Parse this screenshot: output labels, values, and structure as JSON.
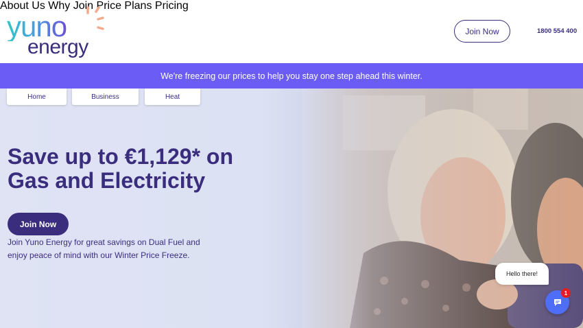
{
  "brand": {
    "logo_top": "yuno",
    "logo_bottom": "energy"
  },
  "nav": {
    "items": [
      "About Us",
      "Why Join",
      "Price Plans",
      "Pricing"
    ],
    "join_label": "Join Now",
    "phone": "1800 554 400"
  },
  "banner": {
    "text": "We're freezing our prices to help you stay one step ahead this winter."
  },
  "tabs": [
    "Home",
    "Business",
    "Heat"
  ],
  "hero": {
    "headline": "Save up to €1,129* on Gas and Electricity",
    "subtext": "Join Yuno Energy for great savings on Dual Fuel and enjoy peace of mind with our Winter Price Freeze.",
    "cta_label": "Join Now"
  },
  "chat": {
    "greeting": "Hello there!",
    "badge_count": "1"
  },
  "colors": {
    "brand_purple": "#3a2d7d",
    "banner": "#6b5cf6",
    "chat_blue": "#4f6ef7",
    "badge_red": "#e02020"
  }
}
